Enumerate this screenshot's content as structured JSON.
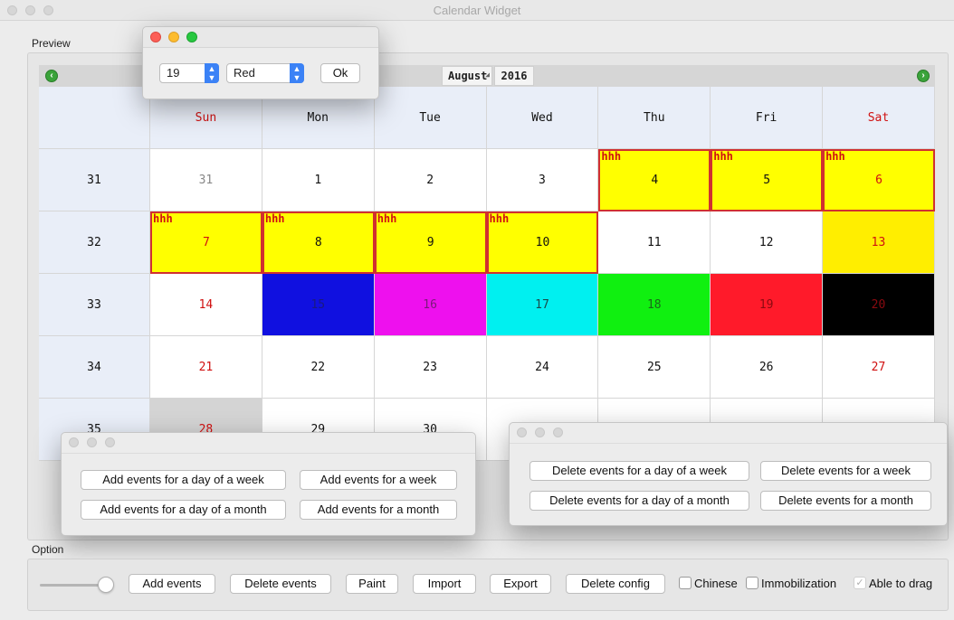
{
  "window": {
    "title": "Calendar Widget"
  },
  "labels": {
    "preview": "Preview",
    "option": "Option"
  },
  "calendar": {
    "month": "August",
    "year": "2016",
    "prev_icon": "arrow-left-icon",
    "next_icon": "arrow-right-icon",
    "headers": [
      "",
      "Sun",
      "Mon",
      "Tue",
      "Wed",
      "Thu",
      "Fri",
      "Sat"
    ],
    "weeks": [
      {
        "week": "31",
        "days": [
          "31",
          "1",
          "2",
          "3",
          "4",
          "5",
          "6"
        ]
      },
      {
        "week": "32",
        "days": [
          "7",
          "8",
          "9",
          "10",
          "11",
          "12",
          "13"
        ]
      },
      {
        "week": "33",
        "days": [
          "14",
          "15",
          "16",
          "17",
          "18",
          "19",
          "20"
        ]
      },
      {
        "week": "34",
        "days": [
          "21",
          "22",
          "23",
          "24",
          "25",
          "26",
          "27"
        ]
      },
      {
        "week": "35",
        "days": [
          "28",
          "29",
          "30",
          "",
          "",
          "",
          ""
        ]
      }
    ],
    "event_tag": "hhh",
    "colors": {
      "weekend": "#d01010",
      "event_bg": "#ffff00",
      "day13": "#ffee00",
      "day15": "#1010e0",
      "day16": "#ee10ee",
      "day17": "#00f0f0",
      "day18": "#10f010",
      "day19": "#ff1a2a",
      "day20": "#000000",
      "day28": "#d4d4d4"
    }
  },
  "color_popup": {
    "day_value": "19",
    "color_value": "Red",
    "ok_label": "Ok"
  },
  "add_popup": {
    "day_of_week": "Add events for a day of a week",
    "week": "Add events for a week",
    "day_of_month": "Add events for a day of a month",
    "month": "Add events for a month"
  },
  "delete_popup": {
    "day_of_week": "Delete events for a day of a week",
    "week": "Delete events for a week",
    "day_of_month": "Delete events for a day of a month",
    "month": "Delete events for a month"
  },
  "options": {
    "add_events": "Add events",
    "delete_events": "Delete events",
    "paint": "Paint",
    "import": "Import",
    "export": "Export",
    "delete_config": "Delete config",
    "chinese": "Chinese",
    "immobilization": "Immobilization",
    "able_to_drag": "Able to drag",
    "slider_level": 0.85
  }
}
